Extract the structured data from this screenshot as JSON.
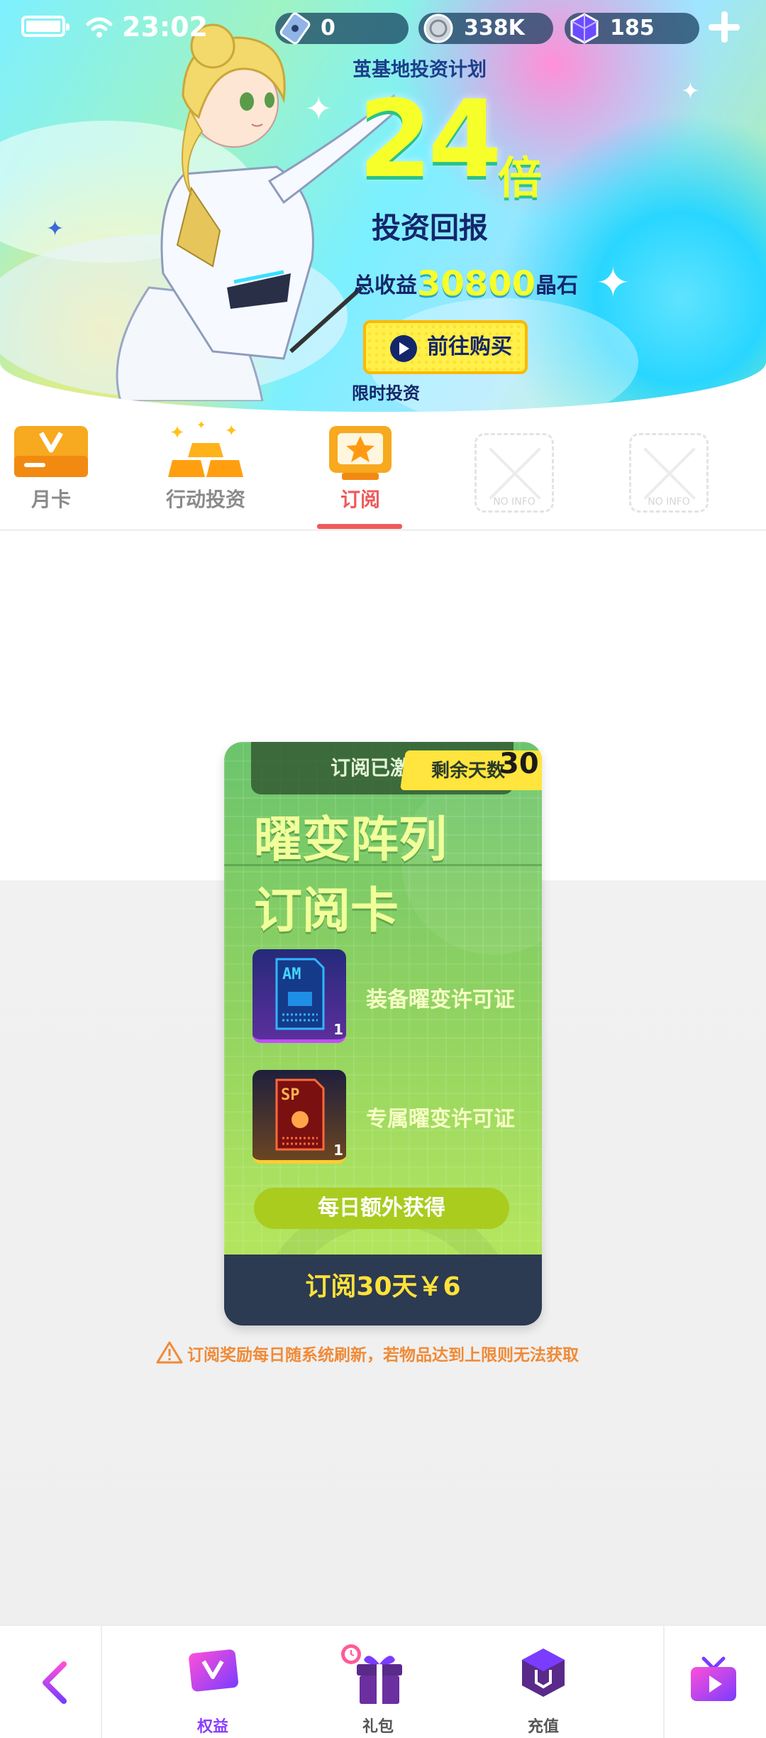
{
  "status_bar": {
    "time": "23:02"
  },
  "resources": {
    "tickets": "0",
    "coins": "338K",
    "crystals": "185"
  },
  "banner": {
    "subtitle": "茧基地投资计划",
    "multiplier": "24",
    "multiplier_unit": "倍",
    "headline": "投资回报",
    "total_prefix": "总收益",
    "total_value": "30800",
    "total_suffix": "晶石",
    "buy_button": "前往购买",
    "limited": "限时投资"
  },
  "tabs": [
    {
      "label": "月卡",
      "icon": "monthly-card-icon"
    },
    {
      "label": "行动投资",
      "icon": "gold-bars-icon"
    },
    {
      "label": "订阅",
      "icon": "subscription-star-icon",
      "active": true
    },
    {
      "label": "NO INFO",
      "icon": "placeholder-icon"
    },
    {
      "label": "NO INFO",
      "icon": "placeholder-icon"
    }
  ],
  "card": {
    "activated": "订阅已激活",
    "days_label": "剩余天数",
    "days_value": "30",
    "title_line1": "曜变阵列",
    "title_line2": "订阅卡",
    "items": [
      {
        "badge": "AM",
        "label": "装备曜变许可证",
        "qty": "1"
      },
      {
        "badge": "SP",
        "label": "专属曜变许可证",
        "qty": "1"
      }
    ],
    "daily_button": "每日额外获得",
    "price_button": "订阅30天￥6"
  },
  "notice": "订阅奖励每日随系统刷新，若物品达到上限则无法获取",
  "bottom_nav": [
    {
      "label": "权益",
      "icon": "benefits-v-icon",
      "active": true
    },
    {
      "label": "礼包",
      "icon": "gift-icon"
    },
    {
      "label": "充值",
      "icon": "recharge-cube-icon"
    }
  ],
  "colors": {
    "accent_red": "#ef5a5a",
    "accent_purple": "#8b3cff",
    "banner_yellow": "#f6ff2a",
    "notice_orange": "#f08a37"
  }
}
